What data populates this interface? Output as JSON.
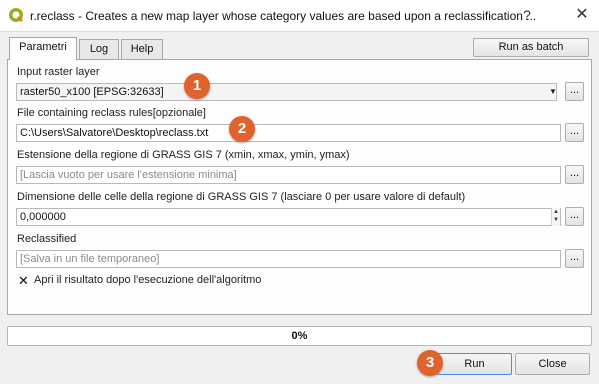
{
  "window": {
    "title": "r.reclass - Creates a new map layer whose category values are based upon a reclassification ...",
    "help_glyph": "?",
    "close_glyph": "✕"
  },
  "tabs": [
    {
      "label": "Parametri",
      "active": true
    },
    {
      "label": "Log",
      "active": false
    },
    {
      "label": "Help",
      "active": false
    }
  ],
  "batch_button": "Run as batch process...",
  "params": {
    "input_raster": {
      "label": "Input raster layer",
      "value": "raster50_x100 [EPSG:32633]"
    },
    "rules_file": {
      "label": "File containing reclass rules[opzionale]",
      "value": "C:\\Users\\Salvatore\\Desktop\\reclass.txt"
    },
    "region_extent": {
      "label": "Estensione della regione di GRASS GIS 7 (xmin, xmax, ymin, ymax)",
      "placeholder": "[Lascia vuoto per usare l'estensione minima]"
    },
    "cell_size": {
      "label": "Dimensione delle celle della regione di GRASS GIS 7 (lasciare 0 per usare valore di default)",
      "value": "0,000000"
    },
    "reclassified": {
      "label": "Reclassified",
      "placeholder": "[Salva in un file temporaneo]"
    },
    "open_output": {
      "label": "Apri il risultato dopo l'esecuzione dell'algoritmo",
      "checked": true
    }
  },
  "browse_label": "...",
  "progress": {
    "value": 0,
    "text": "0%"
  },
  "buttons": {
    "run": "Run",
    "close": "Close"
  },
  "annotations": [
    "1",
    "2",
    "3"
  ],
  "colors": {
    "badge": "#e0622c",
    "progress": "#3a8ee6",
    "run_border": "#4a90d9"
  }
}
